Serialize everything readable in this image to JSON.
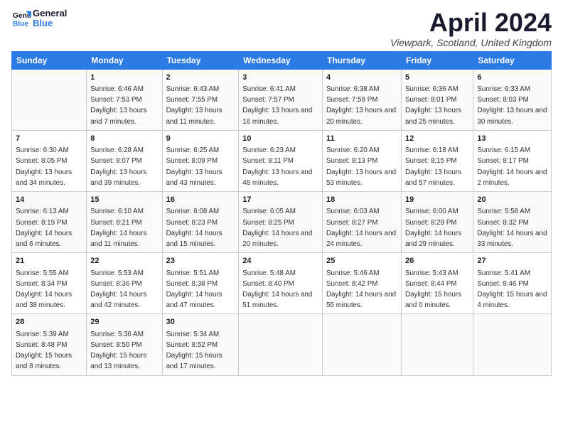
{
  "logo": {
    "line1": "General",
    "line2": "Blue"
  },
  "title": "April 2024",
  "subtitle": "Viewpark, Scotland, United Kingdom",
  "days_header": [
    "Sunday",
    "Monday",
    "Tuesday",
    "Wednesday",
    "Thursday",
    "Friday",
    "Saturday"
  ],
  "weeks": [
    [
      {
        "day": "",
        "sunrise": "",
        "sunset": "",
        "daylight": ""
      },
      {
        "day": "1",
        "sunrise": "Sunrise: 6:46 AM",
        "sunset": "Sunset: 7:53 PM",
        "daylight": "Daylight: 13 hours and 7 minutes."
      },
      {
        "day": "2",
        "sunrise": "Sunrise: 6:43 AM",
        "sunset": "Sunset: 7:55 PM",
        "daylight": "Daylight: 13 hours and 11 minutes."
      },
      {
        "day": "3",
        "sunrise": "Sunrise: 6:41 AM",
        "sunset": "Sunset: 7:57 PM",
        "daylight": "Daylight: 13 hours and 16 minutes."
      },
      {
        "day": "4",
        "sunrise": "Sunrise: 6:38 AM",
        "sunset": "Sunset: 7:59 PM",
        "daylight": "Daylight: 13 hours and 20 minutes."
      },
      {
        "day": "5",
        "sunrise": "Sunrise: 6:36 AM",
        "sunset": "Sunset: 8:01 PM",
        "daylight": "Daylight: 13 hours and 25 minutes."
      },
      {
        "day": "6",
        "sunrise": "Sunrise: 6:33 AM",
        "sunset": "Sunset: 8:03 PM",
        "daylight": "Daylight: 13 hours and 30 minutes."
      }
    ],
    [
      {
        "day": "7",
        "sunrise": "Sunrise: 6:30 AM",
        "sunset": "Sunset: 8:05 PM",
        "daylight": "Daylight: 13 hours and 34 minutes."
      },
      {
        "day": "8",
        "sunrise": "Sunrise: 6:28 AM",
        "sunset": "Sunset: 8:07 PM",
        "daylight": "Daylight: 13 hours and 39 minutes."
      },
      {
        "day": "9",
        "sunrise": "Sunrise: 6:25 AM",
        "sunset": "Sunset: 8:09 PM",
        "daylight": "Daylight: 13 hours and 43 minutes."
      },
      {
        "day": "10",
        "sunrise": "Sunrise: 6:23 AM",
        "sunset": "Sunset: 8:11 PM",
        "daylight": "Daylight: 13 hours and 48 minutes."
      },
      {
        "day": "11",
        "sunrise": "Sunrise: 6:20 AM",
        "sunset": "Sunset: 8:13 PM",
        "daylight": "Daylight: 13 hours and 53 minutes."
      },
      {
        "day": "12",
        "sunrise": "Sunrise: 6:18 AM",
        "sunset": "Sunset: 8:15 PM",
        "daylight": "Daylight: 13 hours and 57 minutes."
      },
      {
        "day": "13",
        "sunrise": "Sunrise: 6:15 AM",
        "sunset": "Sunset: 8:17 PM",
        "daylight": "Daylight: 14 hours and 2 minutes."
      }
    ],
    [
      {
        "day": "14",
        "sunrise": "Sunrise: 6:13 AM",
        "sunset": "Sunset: 8:19 PM",
        "daylight": "Daylight: 14 hours and 6 minutes."
      },
      {
        "day": "15",
        "sunrise": "Sunrise: 6:10 AM",
        "sunset": "Sunset: 8:21 PM",
        "daylight": "Daylight: 14 hours and 11 minutes."
      },
      {
        "day": "16",
        "sunrise": "Sunrise: 6:08 AM",
        "sunset": "Sunset: 8:23 PM",
        "daylight": "Daylight: 14 hours and 15 minutes."
      },
      {
        "day": "17",
        "sunrise": "Sunrise: 6:05 AM",
        "sunset": "Sunset: 8:25 PM",
        "daylight": "Daylight: 14 hours and 20 minutes."
      },
      {
        "day": "18",
        "sunrise": "Sunrise: 6:03 AM",
        "sunset": "Sunset: 8:27 PM",
        "daylight": "Daylight: 14 hours and 24 minutes."
      },
      {
        "day": "19",
        "sunrise": "Sunrise: 6:00 AM",
        "sunset": "Sunset: 8:29 PM",
        "daylight": "Daylight: 14 hours and 29 minutes."
      },
      {
        "day": "20",
        "sunrise": "Sunrise: 5:58 AM",
        "sunset": "Sunset: 8:32 PM",
        "daylight": "Daylight: 14 hours and 33 minutes."
      }
    ],
    [
      {
        "day": "21",
        "sunrise": "Sunrise: 5:55 AM",
        "sunset": "Sunset: 8:34 PM",
        "daylight": "Daylight: 14 hours and 38 minutes."
      },
      {
        "day": "22",
        "sunrise": "Sunrise: 5:53 AM",
        "sunset": "Sunset: 8:36 PM",
        "daylight": "Daylight: 14 hours and 42 minutes."
      },
      {
        "day": "23",
        "sunrise": "Sunrise: 5:51 AM",
        "sunset": "Sunset: 8:38 PM",
        "daylight": "Daylight: 14 hours and 47 minutes."
      },
      {
        "day": "24",
        "sunrise": "Sunrise: 5:48 AM",
        "sunset": "Sunset: 8:40 PM",
        "daylight": "Daylight: 14 hours and 51 minutes."
      },
      {
        "day": "25",
        "sunrise": "Sunrise: 5:46 AM",
        "sunset": "Sunset: 8:42 PM",
        "daylight": "Daylight: 14 hours and 55 minutes."
      },
      {
        "day": "26",
        "sunrise": "Sunrise: 5:43 AM",
        "sunset": "Sunset: 8:44 PM",
        "daylight": "Daylight: 15 hours and 0 minutes."
      },
      {
        "day": "27",
        "sunrise": "Sunrise: 5:41 AM",
        "sunset": "Sunset: 8:46 PM",
        "daylight": "Daylight: 15 hours and 4 minutes."
      }
    ],
    [
      {
        "day": "28",
        "sunrise": "Sunrise: 5:39 AM",
        "sunset": "Sunset: 8:48 PM",
        "daylight": "Daylight: 15 hours and 8 minutes."
      },
      {
        "day": "29",
        "sunrise": "Sunrise: 5:36 AM",
        "sunset": "Sunset: 8:50 PM",
        "daylight": "Daylight: 15 hours and 13 minutes."
      },
      {
        "day": "30",
        "sunrise": "Sunrise: 5:34 AM",
        "sunset": "Sunset: 8:52 PM",
        "daylight": "Daylight: 15 hours and 17 minutes."
      },
      {
        "day": "",
        "sunrise": "",
        "sunset": "",
        "daylight": ""
      },
      {
        "day": "",
        "sunrise": "",
        "sunset": "",
        "daylight": ""
      },
      {
        "day": "",
        "sunrise": "",
        "sunset": "",
        "daylight": ""
      },
      {
        "day": "",
        "sunrise": "",
        "sunset": "",
        "daylight": ""
      }
    ]
  ]
}
